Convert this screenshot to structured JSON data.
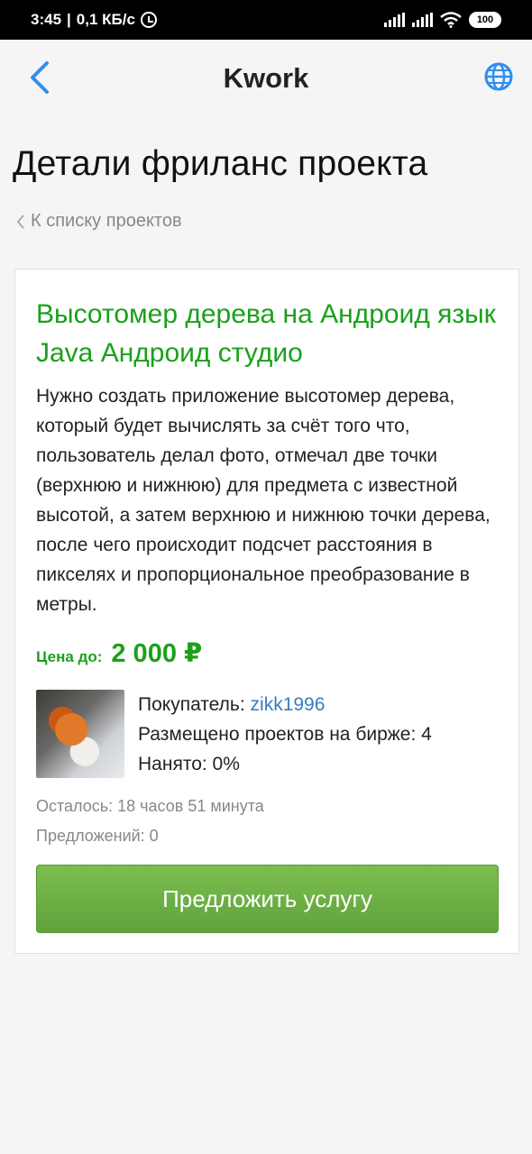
{
  "status_bar": {
    "time": "3:45",
    "speed": "0,1 КБ/с",
    "battery": "100"
  },
  "app_bar": {
    "title": "Kwork"
  },
  "page": {
    "title": "Детали фриланс проекта",
    "breadcrumb": "К списку проектов"
  },
  "project": {
    "title": "Высотомер дерева на Андроид язык Java Андроид студио",
    "description": "Нужно создать приложение высотомер дерева, который будет вычислять за счёт того что, пользователь делал фото, отмечал две точки (верхнюю и нижнюю) для предмета с известной высотой, а затем верхнюю и нижнюю точки дерева, после чего происходит подсчет расстояния в пикселях и пропорциональное преобразование в метры.",
    "price_label": "Цена до:",
    "price_value": "2 000 ₽"
  },
  "buyer": {
    "label": "Покупатель:",
    "name": "zikk1996",
    "posted": "Размещено проектов на бирже: 4",
    "hired": "Нанято: 0%"
  },
  "meta": {
    "time_left": "Осталось: 18 часов 51 минута",
    "offers": "Предложений: 0"
  },
  "cta": {
    "label": "Предложить услугу"
  },
  "colors": {
    "accent_green": "#1ba01b",
    "link_blue": "#3a7bbf",
    "icon_blue": "#2e8ff0"
  }
}
